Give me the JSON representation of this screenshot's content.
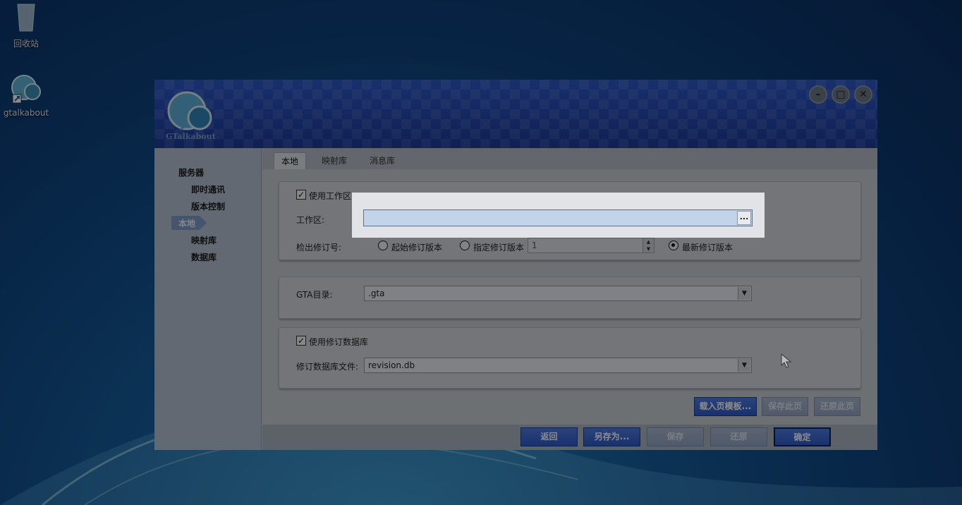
{
  "desktop": {
    "icons": [
      {
        "label": "回收站"
      },
      {
        "label": "gtalkabout"
      }
    ]
  },
  "window": {
    "logo_text": "GTalkabout",
    "controls": {
      "minimize": "–",
      "maximize": "□",
      "close": "✕"
    },
    "sidebar": {
      "items": [
        {
          "label": "服务器",
          "selected": false
        },
        {
          "label": "即时通讯",
          "selected": false
        },
        {
          "label": "版本控制",
          "selected": false
        },
        {
          "label": "本地",
          "selected": true
        },
        {
          "label": "映射库",
          "selected": false
        },
        {
          "label": "数据库",
          "selected": false
        }
      ]
    },
    "tabs": [
      {
        "label": "本地",
        "active": true
      },
      {
        "label": "映射库",
        "active": false
      },
      {
        "label": "消息库",
        "active": false
      }
    ],
    "workspace": {
      "use_workspace_label": "使用工作区",
      "use_workspace_checked": true,
      "workspace_label": "工作区:",
      "workspace_value": "",
      "browse_label": "...",
      "checkout_label": "检出修订号:",
      "radio_start": "起始修订版本",
      "radio_specified": "指定修订版本",
      "specified_value": "1",
      "radio_latest": "最新修订版本",
      "selected_radio": "最新修订版本"
    },
    "gta": {
      "label": "GTA目录:",
      "value": ".gta"
    },
    "revision_db": {
      "use_label": "使用修订数据库",
      "use_checked": true,
      "file_label": "修订数据库文件:",
      "file_value": "revision.db"
    },
    "page_buttons": {
      "load_template": "载入页模板...",
      "save_page": "保存此页",
      "restore_page": "还原此页"
    },
    "footer_buttons": {
      "back": "返回",
      "save_as": "另存为...",
      "save": "保存",
      "restore": "还原",
      "ok": "确定"
    }
  }
}
